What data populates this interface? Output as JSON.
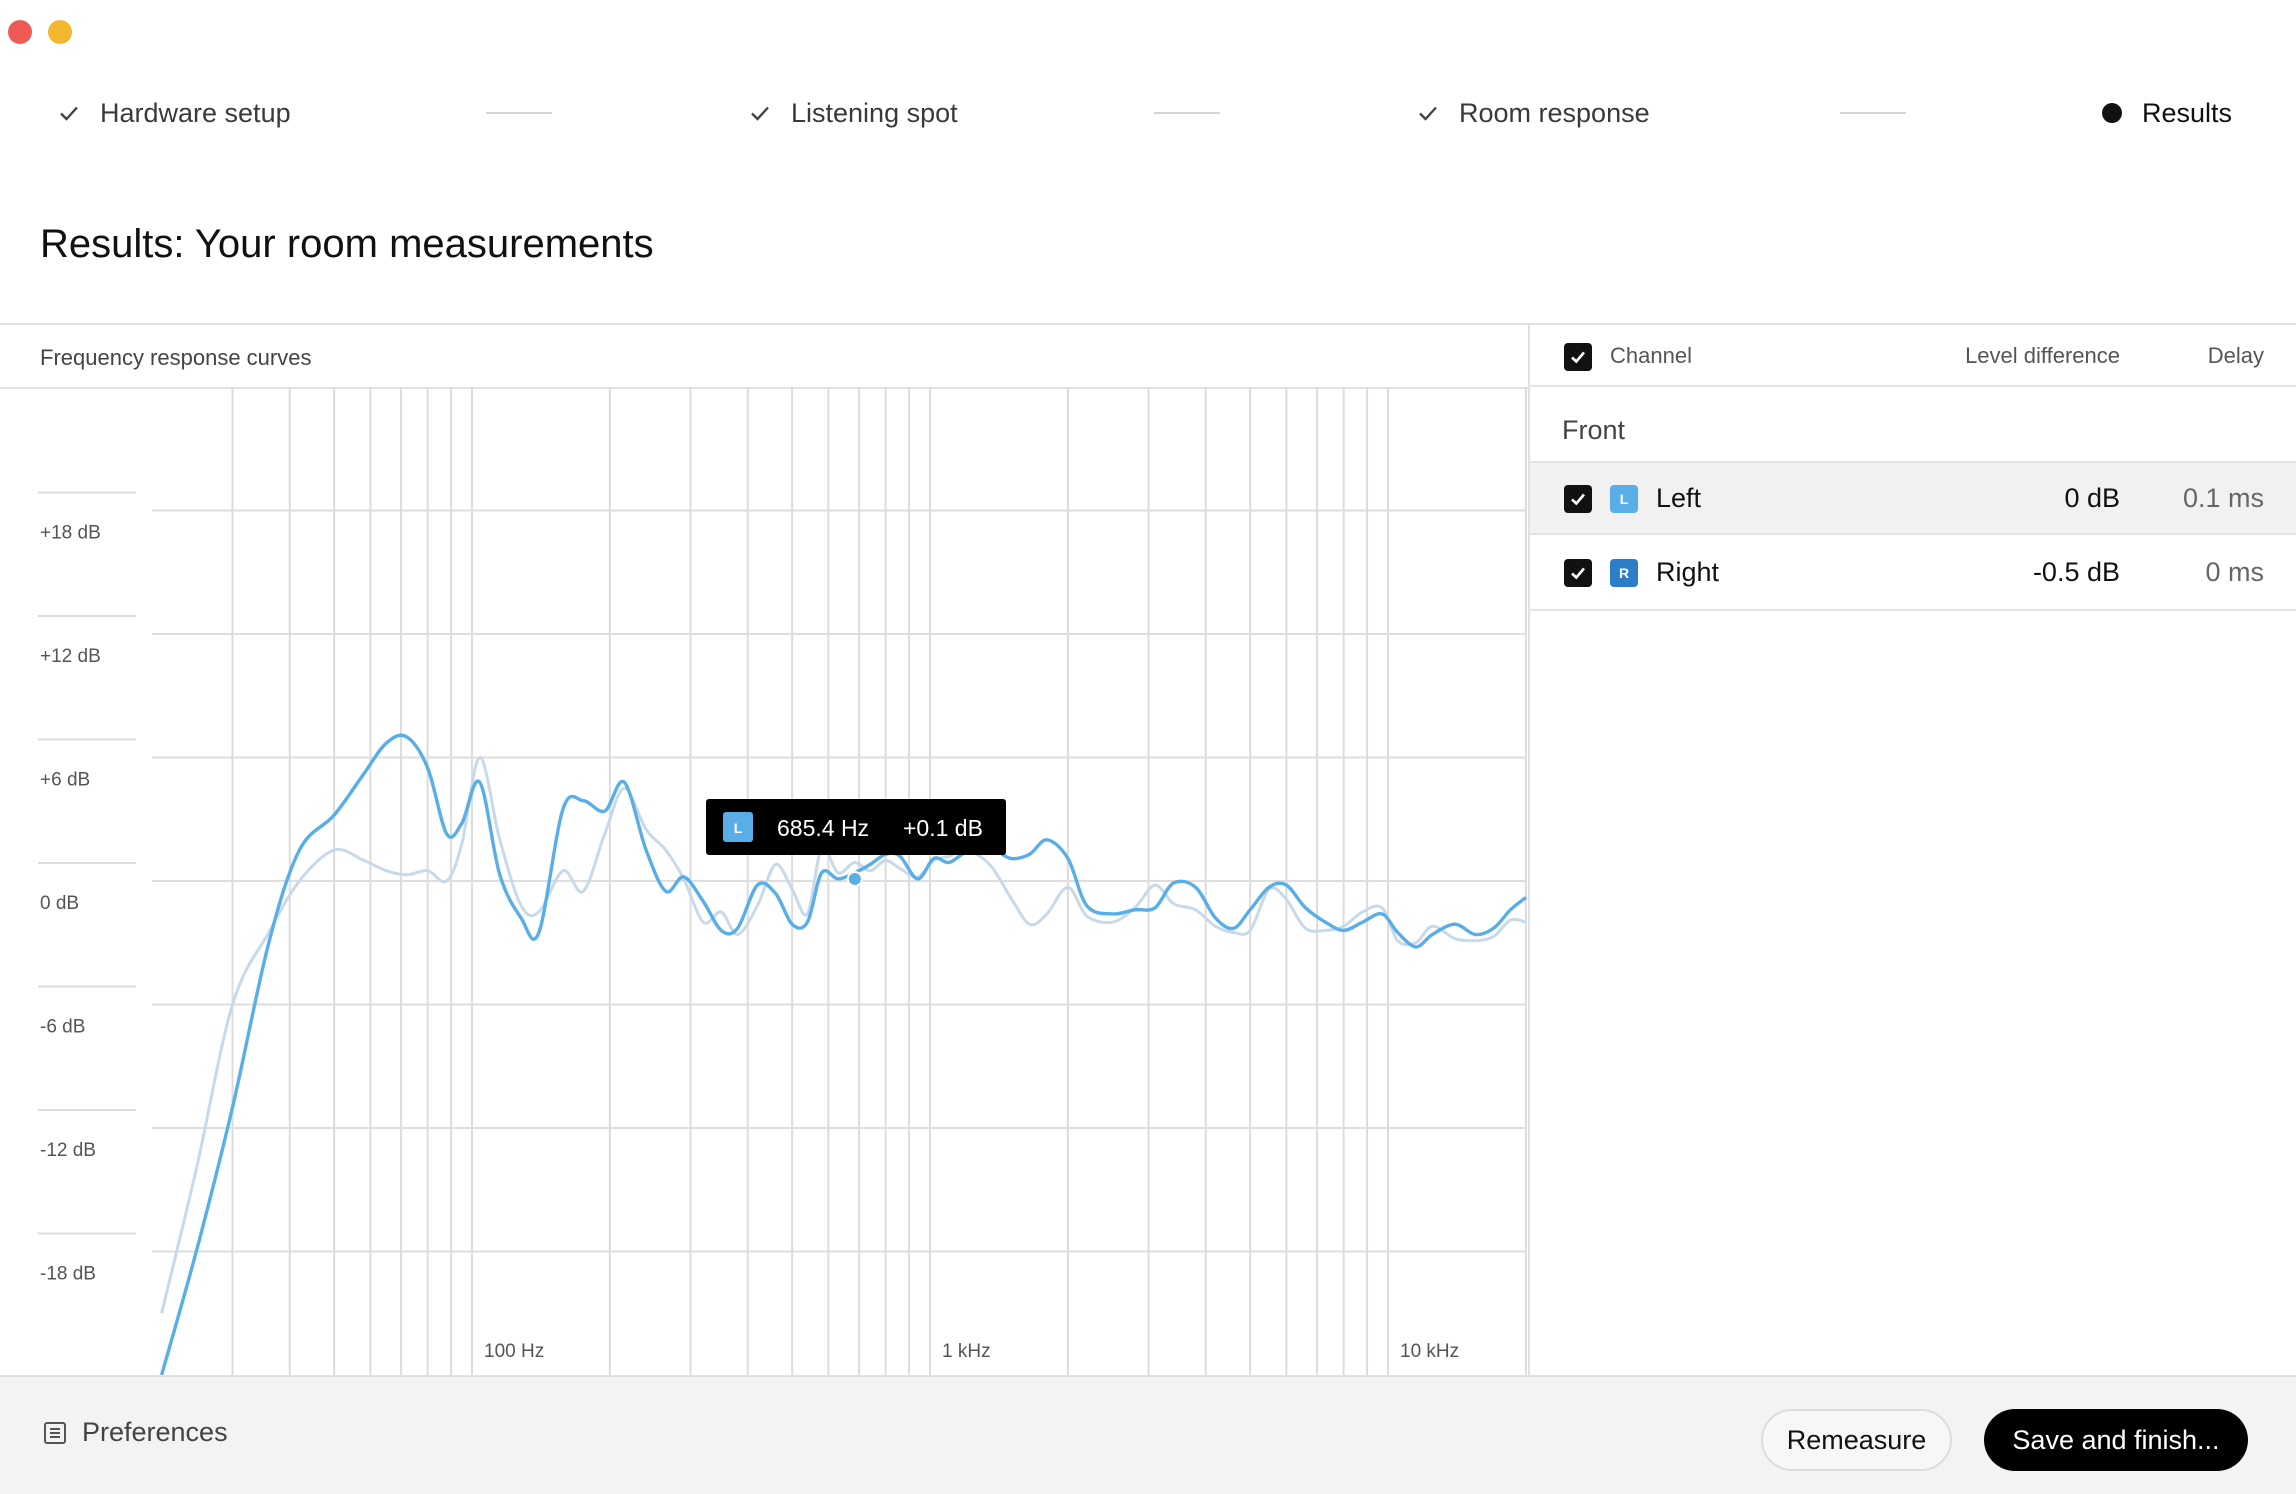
{
  "window": {
    "controls": [
      "close",
      "minimize"
    ]
  },
  "stepper": {
    "steps": [
      {
        "label": "Hardware setup",
        "state": "done"
      },
      {
        "label": "Listening spot",
        "state": "done"
      },
      {
        "label": "Room response",
        "state": "done"
      },
      {
        "label": "Results",
        "state": "active"
      }
    ]
  },
  "page": {
    "title": "Results: Your room measurements"
  },
  "chart": {
    "header": "Frequency response curves",
    "tooltip": {
      "channel": "L",
      "freq": "685.4 Hz",
      "level": "+0.1 dB"
    }
  },
  "chart_data": {
    "type": "line",
    "title": "Frequency response curves",
    "x_scale": "log",
    "xlim": [
      20,
      20000
    ],
    "ylim": [
      -22,
      22
    ],
    "y_ticks": [
      "+18 dB",
      "+12 dB",
      "+6 dB",
      "0 dB",
      "-6 dB",
      "-12 dB",
      "-18 dB"
    ],
    "y_tick_values": [
      18,
      12,
      6,
      0,
      -6,
      -12,
      -18
    ],
    "x_ticks": [
      "100 Hz",
      "1 kHz",
      "10 kHz"
    ],
    "x_tick_values": [
      100,
      1000,
      10000
    ],
    "grid": true,
    "colors": {
      "left": "#5aaee8",
      "right": "#c8d9ea"
    },
    "series": [
      {
        "name": "Left",
        "x": [
          21,
          25,
          30,
          36,
          42,
          50,
          58,
          65,
          72,
          80,
          88,
          95,
          104,
          115,
          128,
          140,
          158,
          175,
          195,
          215,
          240,
          265,
          290,
          320,
          350,
          380,
          420,
          460,
          500,
          540,
          580,
          630,
          685,
          740,
          800,
          860,
          940,
          1020,
          1100,
          1200,
          1350,
          1500,
          1650,
          1800,
          2000,
          2200,
          2500,
          2800,
          3100,
          3400,
          3800,
          4200,
          4600,
          5000,
          5500,
          6000,
          6600,
          7300,
          8000,
          8800,
          9700,
          10500,
          11500,
          12500,
          14000,
          15500,
          17000,
          18500,
          20000
        ],
        "y": [
          -24,
          -18,
          -11,
          -3,
          1.5,
          3.2,
          5.2,
          6.7,
          7.0,
          5.5,
          2.3,
          2.8,
          4.8,
          0.3,
          -1.8,
          -2.5,
          3.5,
          3.9,
          3.4,
          4.8,
          1.5,
          -0.5,
          0.2,
          -1.0,
          -2.4,
          -2.3,
          -0.2,
          -0.6,
          -2.1,
          -2.0,
          0.4,
          0.1,
          0.4,
          0.8,
          1.3,
          1.2,
          0.1,
          1.1,
          0.9,
          1.4,
          1.6,
          1.1,
          1.3,
          2.0,
          1.1,
          -1.2,
          -1.6,
          -1.4,
          -1.3,
          -0.1,
          -0.3,
          -1.8,
          -2.3,
          -1.4,
          -0.3,
          -0.2,
          -1.3,
          -2.0,
          -2.4,
          -2.0,
          -1.6,
          -2.5,
          -3.2,
          -2.6,
          -2.1,
          -2.6,
          -2.3,
          -1.4,
          -0.8
        ]
      },
      {
        "name": "Right",
        "x": [
          21,
          25,
          30,
          36,
          42,
          50,
          58,
          65,
          72,
          80,
          88,
          95,
          104,
          115,
          128,
          140,
          158,
          175,
          195,
          215,
          240,
          265,
          290,
          320,
          350,
          380,
          420,
          460,
          500,
          540,
          580,
          630,
          685,
          740,
          800,
          860,
          940,
          1020,
          1100,
          1200,
          1350,
          1500,
          1650,
          1800,
          2000,
          2200,
          2500,
          2800,
          3100,
          3400,
          3800,
          4200,
          4600,
          5000,
          5500,
          6000,
          6600,
          7300,
          8000,
          8800,
          9700,
          10500,
          11500,
          12500,
          14000,
          15500,
          17000,
          18500,
          20000
        ],
        "y": [
          -21,
          -14,
          -6,
          -2.5,
          0,
          1.5,
          1.0,
          0.5,
          0.3,
          0.5,
          0.0,
          1.8,
          6.0,
          2.0,
          -1.2,
          -1.5,
          0.5,
          -0.5,
          2.3,
          4.5,
          2.5,
          1.5,
          0.1,
          -2.0,
          -1.5,
          -2.6,
          -1.2,
          0.8,
          -0.4,
          -1.6,
          1.6,
          0.4,
          0.9,
          0.5,
          1.0,
          0.6,
          0.2,
          1.0,
          1.2,
          1.5,
          0.8,
          -0.8,
          -2.1,
          -1.6,
          -0.3,
          -1.7,
          -2.0,
          -1.3,
          -0.2,
          -1.1,
          -1.4,
          -2.2,
          -2.5,
          -2.4,
          -0.4,
          -0.9,
          -2.3,
          -2.4,
          -2.2,
          -1.5,
          -1.3,
          -2.9,
          -3.0,
          -2.2,
          -2.8,
          -2.9,
          -2.7,
          -1.9,
          -2.0
        ]
      }
    ]
  },
  "table": {
    "headers": {
      "channel": "Channel",
      "level": "Level difference",
      "delay": "Delay"
    },
    "group": "Front",
    "rows": [
      {
        "badge": "L",
        "badge_color": "#5aaee8",
        "name": "Left",
        "level": "0 dB",
        "delay": "0.1 ms"
      },
      {
        "badge": "R",
        "badge_color": "#2c7fc6",
        "name": "Right",
        "level": "-0.5 dB",
        "delay": "0 ms"
      }
    ]
  },
  "footer": {
    "preferences": "Preferences",
    "remeasure": "Remeasure",
    "save": "Save and finish..."
  }
}
